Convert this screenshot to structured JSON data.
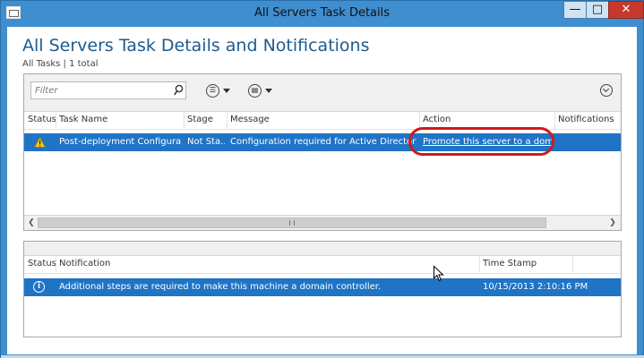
{
  "window": {
    "title": "All Servers Task Details",
    "minimize_label": "—",
    "maximize_label": "□",
    "close_label": "✕"
  },
  "page": {
    "title": "All Servers Task Details and Notifications",
    "subtitle": "All Tasks | 1 total"
  },
  "toolbar": {
    "filter_placeholder": "Filter",
    "list_icon": "list-icon",
    "save_icon": "save-icon",
    "expand_icon": "chevron-down-icon"
  },
  "tasks": {
    "columns": [
      "Status",
      "Task Name",
      "Stage",
      "Message",
      "Action",
      "Notifications"
    ],
    "rows": [
      {
        "status_icon": "warning-icon",
        "task_name": "Post-deployment Configuration",
        "stage": "Not Sta...",
        "message": "Configuration required for Active Directory Do...",
        "action": "Promote this server to a domain...",
        "notifications": ""
      }
    ]
  },
  "notifications": {
    "columns": [
      "Status",
      "Notification",
      "Time Stamp"
    ],
    "rows": [
      {
        "status_icon": "info-icon",
        "notification": "Additional steps are required to make this machine a domain controller.",
        "time_stamp": "10/15/2013 2:10:16 PM"
      }
    ]
  },
  "colors": {
    "selection": "#1f74c5",
    "title_blue": "#1d5b8f",
    "highlight_red": "#d11a1a",
    "frame": "#3e8ed0"
  }
}
